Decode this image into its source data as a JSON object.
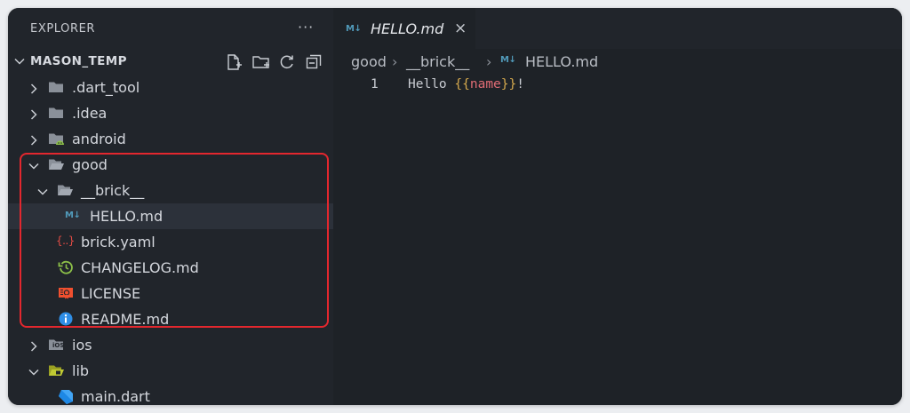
{
  "sidebar": {
    "title": "EXPLORER",
    "more_label": "···",
    "root": {
      "label": "MASON_TEMP",
      "expanded": true
    },
    "items": [
      {
        "label": ".dart_tool",
        "type": "folder",
        "expanded": false,
        "depth": 1,
        "icon": "folder-icon"
      },
      {
        "label": ".idea",
        "type": "folder",
        "expanded": false,
        "depth": 1,
        "icon": "folder-icon"
      },
      {
        "label": "android",
        "type": "folder",
        "expanded": false,
        "depth": 1,
        "icon": "android-folder-icon"
      },
      {
        "label": "good",
        "type": "folder",
        "expanded": true,
        "depth": 1,
        "icon": "folder-open-icon"
      },
      {
        "label": "__brick__",
        "type": "folder",
        "expanded": true,
        "depth": 2,
        "icon": "folder-open-icon"
      },
      {
        "label": "HELLO.md",
        "type": "file",
        "depth": 3,
        "icon": "markdown-icon",
        "selected": true
      },
      {
        "label": "brick.yaml",
        "type": "file",
        "depth": 2,
        "icon": "yaml-icon"
      },
      {
        "label": "CHANGELOG.md",
        "type": "file",
        "depth": 2,
        "icon": "changelog-icon"
      },
      {
        "label": "LICENSE",
        "type": "file",
        "depth": 2,
        "icon": "license-icon"
      },
      {
        "label": "README.md",
        "type": "file",
        "depth": 2,
        "icon": "info-icon"
      },
      {
        "label": "ios",
        "type": "folder",
        "expanded": false,
        "depth": 1,
        "icon": "ios-folder-icon"
      },
      {
        "label": "lib",
        "type": "folder",
        "expanded": true,
        "depth": 1,
        "icon": "lib-folder-icon"
      },
      {
        "label": "main.dart",
        "type": "file",
        "depth": 2,
        "icon": "dart-icon"
      }
    ],
    "yaml_glyph": "{..}",
    "ios_glyph": "iOS"
  },
  "editor": {
    "tab": {
      "label": "HELLO.md",
      "close_label": "×",
      "icon_glyph": "M↓"
    },
    "breadcrumb": [
      "good",
      "__brick__",
      "HELLO.md"
    ],
    "breadcrumb_separator": "›",
    "lines": [
      {
        "number": "1",
        "tokens": [
          {
            "text": "Hello ",
            "kind": "plain"
          },
          {
            "text": "{{",
            "kind": "brace"
          },
          {
            "text": "name",
            "kind": "var"
          },
          {
            "text": "}}",
            "kind": "brace"
          },
          {
            "text": "!",
            "kind": "plain"
          }
        ]
      }
    ]
  },
  "colors": {
    "highlight_border": "#e3272e",
    "markdown_icon": "#519aba",
    "yaml_icon": "#e34c45",
    "changelog_icon": "#8dc149",
    "license_icon": "#f1502f",
    "info_icon": "#2f8ee6",
    "dart_icon": "#42a5f5",
    "folder": "#8a9099",
    "android": "#8dc149",
    "lib_folder": "#c0ca33"
  }
}
